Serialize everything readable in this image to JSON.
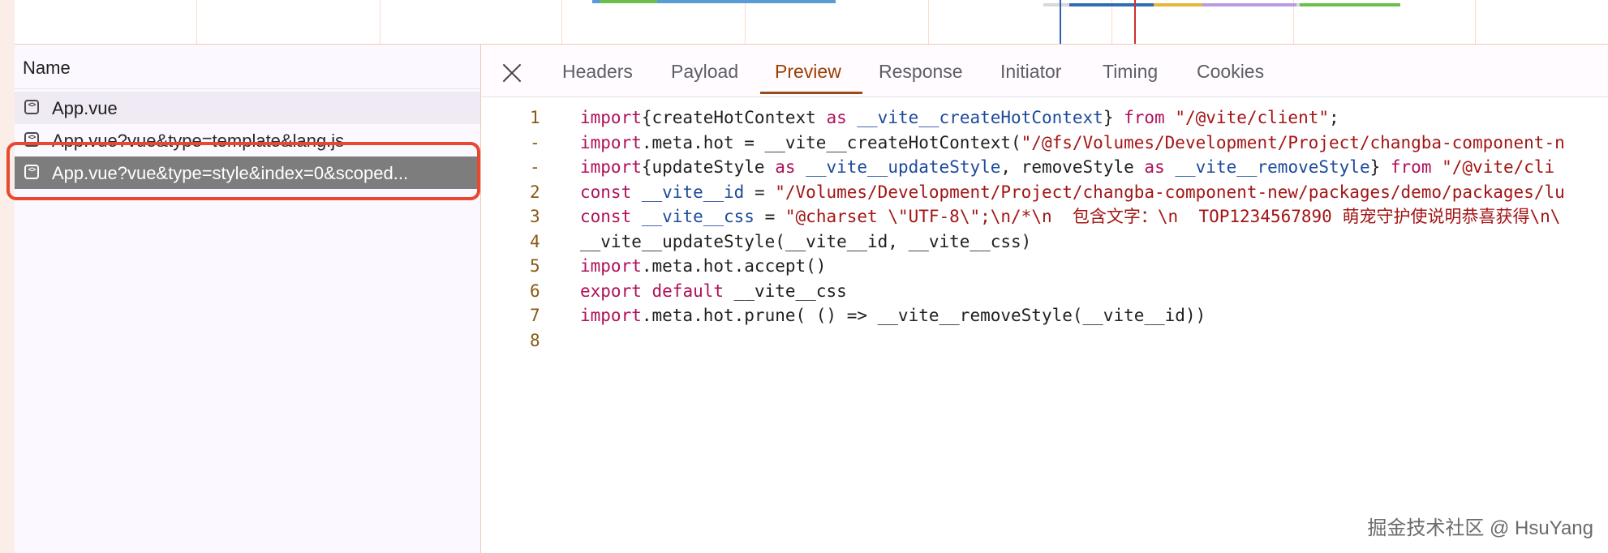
{
  "name_panel": {
    "header": "Name",
    "requests": [
      {
        "label": "App.vue"
      },
      {
        "label": "App.vue?vue&type=template&lang.js"
      },
      {
        "label": "App.vue?vue&type=style&index=0&scoped..."
      }
    ]
  },
  "tabs": [
    "Headers",
    "Payload",
    "Preview",
    "Response",
    "Initiator",
    "Timing",
    "Cookies"
  ],
  "active_tab": "Preview",
  "code_lines": [
    {
      "num": "1",
      "parts": [
        [
          "kw",
          "import"
        ],
        [
          "",
          "{createHotContext "
        ],
        [
          "kw",
          "as"
        ],
        [
          "",
          " "
        ],
        [
          "id",
          "__vite__createHotContext"
        ],
        [
          "",
          "} "
        ],
        [
          "kw",
          "from"
        ],
        [
          "",
          " "
        ],
        [
          "str",
          "\"/@vite/client\""
        ],
        [
          "",
          ";"
        ]
      ]
    },
    {
      "num": "-",
      "parts": [
        [
          "kw",
          "import"
        ],
        [
          "",
          ".meta.hot = __vite__createHotContext("
        ],
        [
          "str",
          "\"/@fs/Volumes/Development/Project/changba-component-n"
        ]
      ]
    },
    {
      "num": "-",
      "parts": [
        [
          "kw",
          "import"
        ],
        [
          "",
          "{updateStyle "
        ],
        [
          "kw",
          "as"
        ],
        [
          "",
          " "
        ],
        [
          "id",
          "__vite__updateStyle"
        ],
        [
          "",
          ", removeStyle "
        ],
        [
          "kw",
          "as"
        ],
        [
          "",
          " "
        ],
        [
          "id",
          "__vite__removeStyle"
        ],
        [
          "",
          "} "
        ],
        [
          "kw",
          "from"
        ],
        [
          "",
          " "
        ],
        [
          "str",
          "\"/@vite/cli"
        ]
      ]
    },
    {
      "num": "2",
      "parts": [
        [
          "kw",
          "const"
        ],
        [
          "",
          " "
        ],
        [
          "id",
          "__vite__id"
        ],
        [
          "",
          " = "
        ],
        [
          "str",
          "\"/Volumes/Development/Project/changba-component-new/packages/demo/packages/lu"
        ]
      ]
    },
    {
      "num": "3",
      "parts": [
        [
          "kw",
          "const"
        ],
        [
          "",
          " "
        ],
        [
          "id",
          "__vite__css"
        ],
        [
          "",
          " = "
        ],
        [
          "str",
          "\"@charset \\\"UTF-8\\\";\\n/*\\n  包含文字：\\n  TOP1234567890 萌宠守护使说明恭喜获得\\n\\"
        ]
      ]
    },
    {
      "num": "4",
      "parts": [
        [
          "",
          "__vite__updateStyle(__vite__id, __vite__css)"
        ]
      ]
    },
    {
      "num": "5",
      "parts": [
        [
          "kw",
          "import"
        ],
        [
          "",
          ".meta.hot.accept()"
        ]
      ]
    },
    {
      "num": "6",
      "parts": [
        [
          "kw",
          "export"
        ],
        [
          "",
          " "
        ],
        [
          "kw",
          "default"
        ],
        [
          "",
          " __vite__css"
        ]
      ]
    },
    {
      "num": "7",
      "parts": [
        [
          "kw",
          "import"
        ],
        [
          "",
          ".meta.hot.prune( () => __vite__removeStyle(__vite__id))"
        ]
      ]
    },
    {
      "num": "8",
      "parts": [
        [
          "",
          ""
        ]
      ]
    }
  ],
  "watermark": "掘金技术社区 @ HsuYang",
  "colors": {
    "accent": "#9b3e00",
    "highlight": "#e8482f",
    "selected_row": "#7d7d7d"
  }
}
